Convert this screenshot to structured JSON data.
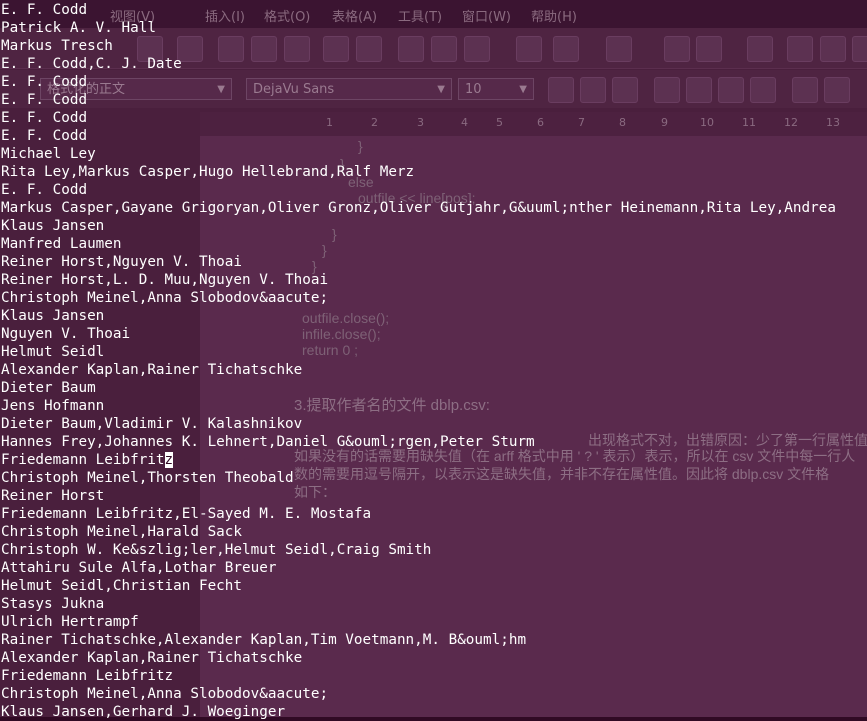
{
  "background_app": {
    "menu": [
      "视图(V)",
      "插入(I)",
      "格式(O)",
      "表格(A)",
      "工具(T)",
      "窗口(W)",
      "帮助(H)"
    ],
    "style_combo": "格式化的正文",
    "font_combo": "DejaVu Sans",
    "size_combo": "10",
    "ruler": [
      "1",
      "2",
      "3",
      "4",
      "5",
      "6",
      "7",
      "8",
      "9",
      "10",
      "11",
      "12",
      "13"
    ],
    "doc_code": [
      "}",
      "}",
      "else",
      "outfile << line[pos];",
      "}",
      "}",
      "}",
      "outfile.close();",
      "infile.close();",
      "return 0 ;"
    ],
    "doc_heading": "3.提取作者名的文件 dblp.csv:",
    "doc_para": [
      "如果没有的话需要用缺失值（在 arff 格式中用 ' ? ' 表示）表示，所以在 csv 文件中每一行人",
      "数的需要用逗号隔开，以表示这是缺失值，并非不存在属性值。因此将 dblp.csv 文件格",
      "如下："
    ],
    "doc_para_prefix": "出现格式不对，出错原因：少了第一行属性值，以及每"
  },
  "terminal": {
    "lines": [
      "E. F. Codd",
      "Patrick A. V. Hall",
      "Markus Tresch",
      "E. F. Codd,C. J. Date",
      "E. F. Codd",
      "E. F. Codd",
      "E. F. Codd",
      "E. F. Codd",
      "Michael Ley",
      "Rita Ley,Markus Casper,Hugo Hellebrand,Ralf Merz",
      "E. F. Codd",
      "Markus Casper,Gayane Grigoryan,Oliver Gronz,Oliver Gutjahr,G&uuml;nther Heinemann,Rita Ley,Andrea",
      "Klaus Jansen",
      "Manfred Laumen",
      "Reiner Horst,Nguyen V. Thoai",
      "Reiner Horst,L. D. Muu,Nguyen V. Thoai",
      "Christoph Meinel,Anna Slobodov&aacute;",
      "Klaus Jansen",
      "Nguyen V. Thoai",
      "Helmut Seidl",
      "Alexander Kaplan,Rainer Tichatschke",
      "Dieter Baum",
      "Jens Hofmann",
      "Dieter Baum,Vladimir V. Kalashnikov",
      "Hannes Frey,Johannes K. Lehnert,Daniel G&ouml;rgen,Peter Sturm",
      "Friedemann Leibfritz",
      "Christoph Meinel,Thorsten Theobald",
      "Reiner Horst",
      "Friedemann Leibfritz,El-Sayed M. E. Mostafa",
      "Christoph Meinel,Harald Sack",
      "Christoph W. Ke&szlig;ler,Helmut Seidl,Craig Smith",
      "Attahiru Sule Alfa,Lothar Breuer",
      "Helmut Seidl,Christian Fecht",
      "Stasys Jukna",
      "Ulrich Hertrampf",
      "Rainer Tichatschke,Alexander Kaplan,Tim Voetmann,M. B&ouml;hm",
      "Alexander Kaplan,Rainer Tichatschke",
      "Friedemann Leibfritz",
      "Christoph Meinel,Anna Slobodov&aacute;",
      "Klaus Jansen,Gerhard J. Woeginger"
    ],
    "cursor_line": 25,
    "cursor_line_text": "Friedemann Leibfrit",
    "cursor_char": "z"
  }
}
